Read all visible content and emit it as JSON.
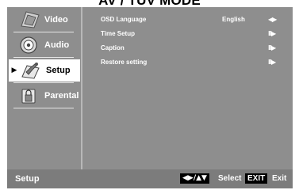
{
  "header": {
    "title": "AV / TUV MODE"
  },
  "sidebar": {
    "items": [
      {
        "label": "Video",
        "icon": "video-icon",
        "selected": false
      },
      {
        "label": "Audio",
        "icon": "audio-icon",
        "selected": false
      },
      {
        "label": "Setup",
        "icon": "setup-icon",
        "selected": true,
        "marker": "▶"
      },
      {
        "label": "Parental",
        "icon": "parental-icon",
        "selected": false
      }
    ]
  },
  "settings": {
    "rows": [
      {
        "name": "OSD Language",
        "value": "English",
        "control": "◀▶"
      },
      {
        "name": "Time Setup",
        "value": "",
        "control": "II▶"
      },
      {
        "name": "Caption",
        "value": "",
        "control": "II▶"
      },
      {
        "name": "Restore setting",
        "value": "",
        "control": "II▶"
      }
    ]
  },
  "footer": {
    "section": "Setup",
    "nav_key": "◀▶/▲▼",
    "select_label": "Select",
    "exit_key": "EXIT",
    "exit_label": "Exit"
  },
  "colors": {
    "panel": "#8e8e8e",
    "footer": "#7c7c7c",
    "selected": "#ffffff",
    "text": "#ffffff"
  }
}
